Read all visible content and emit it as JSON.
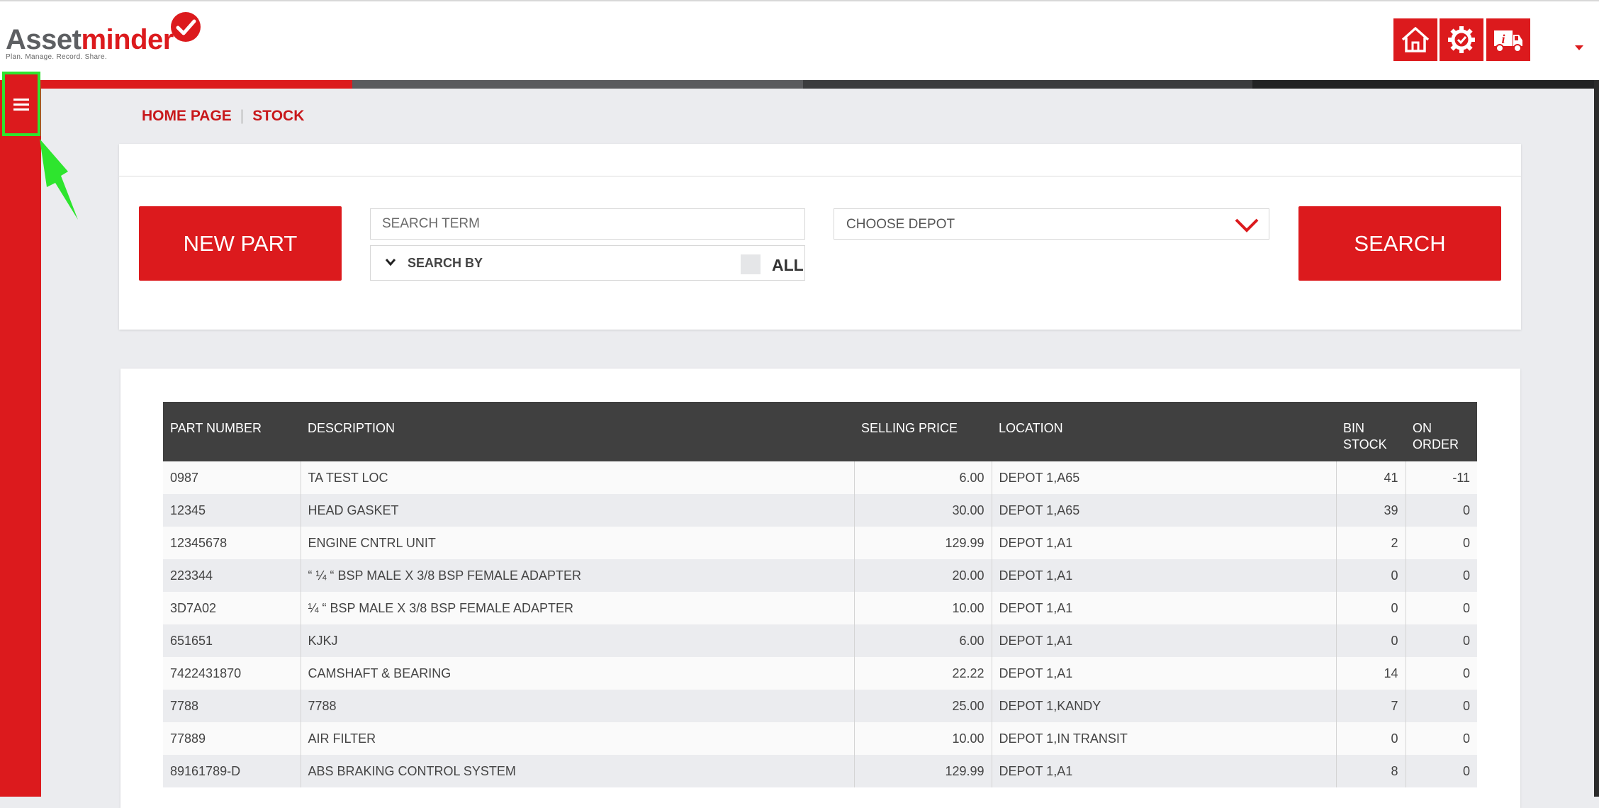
{
  "logo": {
    "word_a": "Asset",
    "word_b": "minder",
    "tagline": "Plan. Manage. Record. Share."
  },
  "header": {
    "buttons": [
      {
        "name": "home-button",
        "icon": "home-icon"
      },
      {
        "name": "settings-button",
        "icon": "gear-icon"
      },
      {
        "name": "fleet-info-button",
        "icon": "truck-info-icon"
      }
    ],
    "user_menu_icon": "caret-down-icon"
  },
  "sidebar": {
    "menu_icon": "hamburger-icon"
  },
  "breadcrumb": {
    "home": "HOME PAGE",
    "separator": "|",
    "current": "STOCK"
  },
  "toolbar": {
    "new_part_label": "NEW PART",
    "search_placeholder": "SEARCH TERM",
    "search_by_label": "SEARCH BY",
    "all_label": "ALL",
    "depot_placeholder": "CHOOSE DEPOT",
    "search_label": "SEARCH"
  },
  "table": {
    "headers": [
      "PART NUMBER",
      "DESCRIPTION",
      "SELLING PRICE",
      "LOCATION",
      "BIN STOCK",
      "ON ORDER"
    ],
    "rows": [
      [
        "0987",
        "TA TEST LOC",
        "6.00",
        "DEPOT 1,A65",
        "41",
        "-11"
      ],
      [
        "12345",
        "HEAD GASKET",
        "30.00",
        "DEPOT 1,A65",
        "39",
        "0"
      ],
      [
        "12345678",
        "ENGINE CNTRL UNIT",
        "129.99",
        "DEPOT 1,A1",
        "2",
        "0"
      ],
      [
        "223344",
        "“ ¼ “ BSP MALE X 3/8 BSP FEMALE ADAPTER",
        "20.00",
        "DEPOT 1,A1",
        "0",
        "0"
      ],
      [
        "3D7A02",
        "¼ “ BSP MALE X 3/8 BSP FEMALE ADAPTER",
        "10.00",
        "DEPOT 1,A1",
        "0",
        "0"
      ],
      [
        "651651",
        "KJKJ",
        "6.00",
        "DEPOT 1,A1",
        "0",
        "0"
      ],
      [
        "7422431870",
        "CAMSHAFT & BEARING",
        "22.22",
        "DEPOT 1,A1",
        "14",
        "0"
      ],
      [
        "7788",
        "7788",
        "25.00",
        "DEPOT 1,KANDY",
        "7",
        "0"
      ],
      [
        "77889",
        "AIR FILTER",
        "10.00",
        "DEPOT 1,IN TRANSIT",
        "0",
        "0"
      ],
      [
        "89161789-D",
        "ABS BRAKING CONTROL SYSTEM",
        "129.99",
        "DEPOT 1,A1",
        "8",
        "0"
      ]
    ]
  },
  "colors": {
    "brand_red": "#dc1a1d",
    "table_header": "#404040",
    "highlight": "#2ee52e",
    "background": "#ebecef"
  }
}
